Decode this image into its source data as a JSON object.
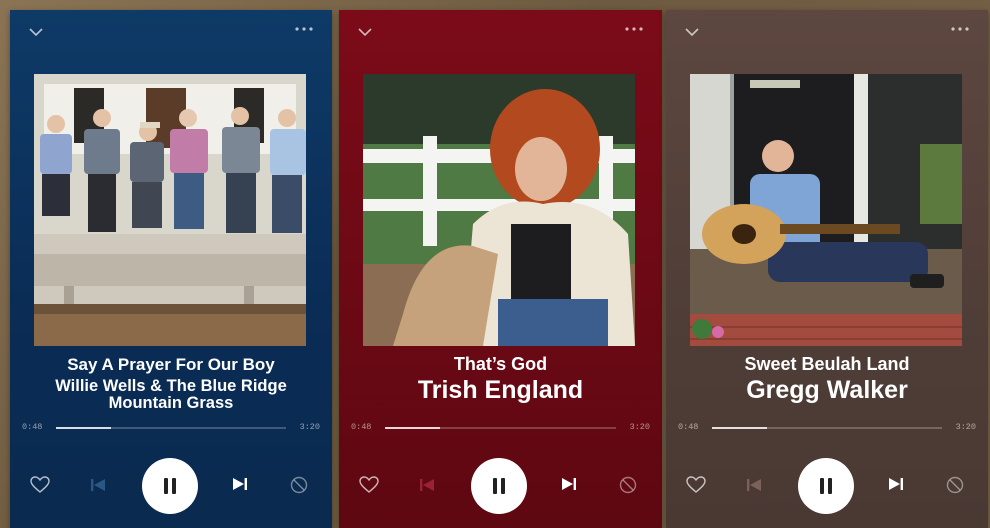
{
  "cards": [
    {
      "song": "Say A Prayer For Our Boy",
      "artist": "Willie Wells & The Blue Ridge Mountain Grass",
      "elapsed": "0:48",
      "total": "3:20",
      "progress": 0.24,
      "bg": "#0e3a67"
    },
    {
      "song": "That’s God",
      "artist": "Trish England",
      "elapsed": "0:48",
      "total": "3:20",
      "progress": 0.24,
      "bg": "#7c0b19"
    },
    {
      "song": "Sweet Beulah Land",
      "artist": "Gregg Walker",
      "elapsed": "0:48",
      "total": "3:20",
      "progress": 0.24,
      "bg": "#5d4740"
    }
  ],
  "icons": [
    "chevron-down-icon",
    "more-icon",
    "heart-icon",
    "previous-icon",
    "pause-icon",
    "next-icon",
    "block-icon"
  ]
}
